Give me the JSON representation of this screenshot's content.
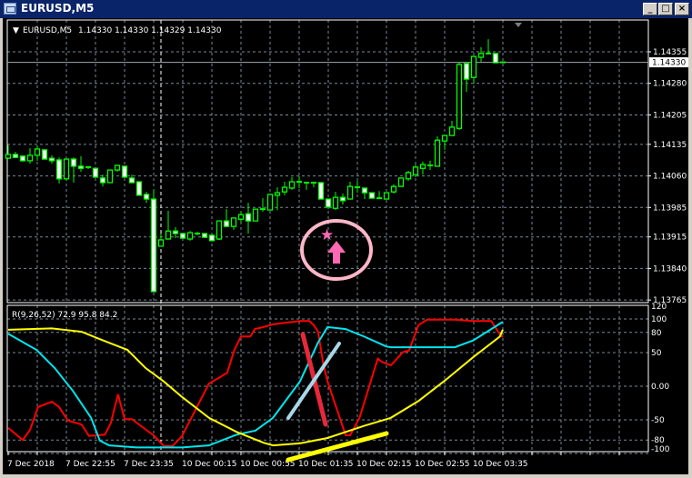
{
  "window": {
    "title": "EURUSD,M5",
    "minimize": "_",
    "maximize": "□",
    "close": "×"
  },
  "colors": {
    "background": "#000000",
    "grid": "#778899",
    "candle": "#00ff00",
    "bear_body": "#ffffff",
    "bull_body": "#000000",
    "axis_text": "#ffffff",
    "ask_line": "#a0a8b0",
    "red_line": "#ff0000",
    "cyan_line": "#00e5ee",
    "yellow_line": "#ffff00",
    "annotation_pink": "#ffb6c8",
    "marker_pink": "#ff69b4"
  },
  "header": {
    "symbol": "EURUSD,M5",
    "ohlc": "1.14330 1.14330 1.14329 1.14330"
  },
  "price_axis": {
    "labels": [
      "1.14355",
      "1.14280",
      "1.14205",
      "1.14135",
      "1.14060",
      "1.13985",
      "1.13915",
      "1.13840",
      "1.13765"
    ],
    "current_price": "1.14330"
  },
  "indicator": {
    "label": "R(9,26,52) 72.9 95.8 84.2",
    "axis_labels": [
      "120",
      "100",
      "80",
      "50",
      "0.00",
      "-50",
      "-80",
      "-100"
    ]
  },
  "time_axis": {
    "labels": [
      "7 Dec 2018",
      "7 Dec 22:55",
      "7 Dec 23:35",
      "10 Dec 00:15",
      "10 Dec 00:55",
      "10 Dec 01:35",
      "10 Dec 02:15",
      "10 Dec 02:55",
      "10 Dec 03:35"
    ]
  },
  "candles_ohlc": [
    [
      1.14102,
      1.14133,
      1.141,
      1.14111
    ],
    [
      1.14111,
      1.14117,
      1.14102,
      1.14104
    ],
    [
      1.14107,
      1.14109,
      1.14094,
      1.14096
    ],
    [
      1.14096,
      1.14126,
      1.14089,
      1.14109
    ],
    [
      1.14109,
      1.14132,
      1.14096,
      1.14124
    ],
    [
      1.14122,
      1.14122,
      1.141,
      1.141
    ],
    [
      1.14102,
      1.14109,
      1.14089,
      1.14096
    ],
    [
      1.14098,
      1.14104,
      1.14042,
      1.14053
    ],
    [
      1.14053,
      1.141,
      1.14048,
      1.141
    ],
    [
      1.141,
      1.14104,
      1.14044,
      1.14083
    ],
    [
      1.14083,
      1.14107,
      1.1407,
      1.14078
    ],
    [
      1.14078,
      1.14081,
      1.14076,
      1.14081
    ],
    [
      1.14078,
      1.14078,
      1.14057,
      1.14057
    ],
    [
      1.14055,
      1.14063,
      1.14035,
      1.14044
    ],
    [
      1.14044,
      1.14074,
      1.14044,
      1.14074
    ],
    [
      1.14074,
      1.14085,
      1.1407,
      1.14085
    ],
    [
      1.14083,
      1.14083,
      1.14057,
      1.14057
    ],
    [
      1.14055,
      1.14063,
      1.14044,
      1.14044
    ],
    [
      1.14046,
      1.14046,
      1.14014,
      1.14014
    ],
    [
      1.14016,
      1.14022,
      1.13996,
      1.14005
    ],
    [
      1.14005,
      1.14027,
      1.13785,
      1.13785
    ],
    [
      1.13893,
      1.13923,
      1.13893,
      1.13908
    ],
    [
      1.1391,
      1.13977,
      1.1391,
      1.13929
    ],
    [
      1.13929,
      1.13938,
      1.13912,
      1.13923
    ],
    [
      1.13923,
      1.13923,
      1.13912,
      1.13912
    ],
    [
      1.1391,
      1.13929,
      1.13906,
      1.13925
    ],
    [
      1.13923,
      1.13927,
      1.13919,
      1.13923
    ],
    [
      1.13923,
      1.13923,
      1.13914,
      1.13914
    ],
    [
      1.13919,
      1.13919,
      1.13906,
      1.13906
    ],
    [
      1.1391,
      1.13953,
      1.13908,
      1.13953
    ],
    [
      1.13953,
      1.13981,
      1.1394,
      1.1394
    ],
    [
      1.1394,
      1.1396,
      1.13932,
      1.1396
    ],
    [
      1.13957,
      1.13975,
      1.13949,
      1.13968
    ],
    [
      1.1397,
      1.13996,
      1.13923,
      1.13953
    ],
    [
      1.13953,
      1.13981,
      1.13953,
      1.13981
    ],
    [
      1.13981,
      1.14007,
      1.13975,
      1.13981
    ],
    [
      1.13979,
      1.14016,
      1.13979,
      1.14016
    ],
    [
      1.14014,
      1.14033,
      1.13979,
      1.1402
    ],
    [
      1.14022,
      1.14046,
      1.14014,
      1.14033
    ],
    [
      1.14031,
      1.14057,
      1.14027,
      1.14046
    ],
    [
      1.14046,
      1.14059,
      1.14031,
      1.14046
    ],
    [
      1.14044,
      1.14044,
      1.14027,
      1.14044
    ],
    [
      1.14044,
      1.14044,
      1.14033,
      1.14044
    ],
    [
      1.14044,
      1.14044,
      1.14005,
      1.14005
    ],
    [
      1.14005,
      1.14005,
      1.13981,
      1.13986
    ],
    [
      1.13983,
      1.14022,
      1.13979,
      1.14009
    ],
    [
      1.14009,
      1.14018,
      1.13992,
      1.14001
    ],
    [
      1.14005,
      1.14046,
      1.14005,
      1.14035
    ],
    [
      1.14033,
      1.14048,
      1.1402,
      1.14033
    ],
    [
      1.14031,
      1.14031,
      1.14005,
      1.1402
    ],
    [
      1.1402,
      1.1402,
      1.14007,
      1.14007
    ],
    [
      1.14007,
      1.14024,
      1.14005,
      1.14007
    ],
    [
      1.14005,
      1.1402,
      1.14005,
      1.1402
    ],
    [
      1.14022,
      1.1404,
      1.14018,
      1.14035
    ],
    [
      1.14035,
      1.14055,
      1.14035,
      1.14055
    ],
    [
      1.14053,
      1.14072,
      1.14048,
      1.14068
    ],
    [
      1.14063,
      1.14087,
      1.14057,
      1.14081
    ],
    [
      1.14078,
      1.14094,
      1.14063,
      1.14087
    ],
    [
      1.14085,
      1.14096,
      1.14074,
      1.14085
    ],
    [
      1.14083,
      1.14154,
      1.14083,
      1.14145
    ],
    [
      1.14143,
      1.14156,
      1.14122,
      1.14156
    ],
    [
      1.14156,
      1.14191,
      1.14156,
      1.14176
    ],
    [
      1.14173,
      1.14329,
      1.14169,
      1.14325
    ],
    [
      1.14327,
      1.14327,
      1.1426,
      1.1429
    ],
    [
      1.14294,
      1.14344,
      1.14279,
      1.14344
    ],
    [
      1.14342,
      1.14366,
      1.14331,
      1.14351
    ],
    [
      1.14351,
      1.14385,
      1.14351,
      1.14351
    ],
    [
      1.14351,
      1.14351,
      1.14329,
      1.14329
    ],
    [
      1.1433,
      1.1433,
      1.14329,
      1.1433
    ]
  ],
  "indicator_series": {
    "red": [
      [
        0,
        -62
      ],
      [
        2,
        -80
      ],
      [
        3,
        -65
      ],
      [
        4.1,
        -31
      ],
      [
        6,
        -23
      ],
      [
        7,
        -31
      ],
      [
        8.2,
        -51
      ],
      [
        10.1,
        -57
      ],
      [
        11.1,
        -74
      ],
      [
        13.3,
        -72
      ],
      [
        14.1,
        -55
      ],
      [
        15.1,
        -12
      ],
      [
        16,
        -49
      ],
      [
        17,
        -49
      ],
      [
        20.1,
        -74
      ],
      [
        21.4,
        -89
      ],
      [
        22.6,
        -89
      ],
      [
        23.9,
        -74
      ],
      [
        25.8,
        -34
      ],
      [
        27.6,
        4
      ],
      [
        28.9,
        12
      ],
      [
        30.1,
        20
      ],
      [
        31.1,
        54
      ],
      [
        32,
        74
      ],
      [
        33.3,
        74
      ],
      [
        33.9,
        85
      ],
      [
        35.1,
        88
      ],
      [
        36.4,
        92
      ],
      [
        40.1,
        97
      ],
      [
        41.4,
        97
      ],
      [
        42,
        91
      ],
      [
        42.6,
        81
      ],
      [
        43.3,
        34
      ],
      [
        43.9,
        7
      ],
      [
        45.8,
        -54
      ],
      [
        46.4,
        -73
      ],
      [
        47,
        -73
      ],
      [
        48.3,
        -47
      ],
      [
        50.8,
        41
      ],
      [
        51.4,
        36
      ],
      [
        52.6,
        31
      ],
      [
        54.3,
        51
      ],
      [
        55.1,
        53
      ],
      [
        56.4,
        91
      ],
      [
        57.6,
        99
      ],
      [
        61.4,
        99
      ],
      [
        63.9,
        97
      ],
      [
        66.4,
        97
      ],
      [
        67.6,
        77
      ],
      [
        68,
        72.9
      ]
    ],
    "cyan": [
      [
        0,
        78
      ],
      [
        3.9,
        54
      ],
      [
        6.4,
        27
      ],
      [
        8.9,
        -7
      ],
      [
        11.4,
        -47
      ],
      [
        12.6,
        -81
      ],
      [
        13.9,
        -88
      ],
      [
        17.6,
        -91
      ],
      [
        23.9,
        -91
      ],
      [
        27.6,
        -88
      ],
      [
        31.4,
        -72
      ],
      [
        34,
        -66
      ],
      [
        36.4,
        -47
      ],
      [
        40.1,
        7
      ],
      [
        42.6,
        65
      ],
      [
        43.9,
        88
      ],
      [
        46.4,
        85
      ],
      [
        48.9,
        74
      ],
      [
        52,
        59
      ],
      [
        52.6,
        58
      ],
      [
        61.4,
        58
      ],
      [
        63.9,
        68
      ],
      [
        68,
        95.8
      ]
    ],
    "yellow": [
      [
        0,
        84
      ],
      [
        6,
        86
      ],
      [
        10.1,
        81
      ],
      [
        12.6,
        70
      ],
      [
        16.4,
        54
      ],
      [
        18.9,
        27
      ],
      [
        21.4,
        7
      ],
      [
        23.9,
        -16
      ],
      [
        27.6,
        -47
      ],
      [
        31.4,
        -68
      ],
      [
        35.1,
        -84
      ],
      [
        36.4,
        -88
      ],
      [
        40.1,
        -85
      ],
      [
        43.9,
        -77
      ],
      [
        48.9,
        -59
      ],
      [
        52.6,
        -47
      ],
      [
        56.4,
        -22
      ],
      [
        60.1,
        9
      ],
      [
        63.9,
        43
      ],
      [
        67.6,
        74
      ],
      [
        68,
        84.2
      ]
    ]
  }
}
